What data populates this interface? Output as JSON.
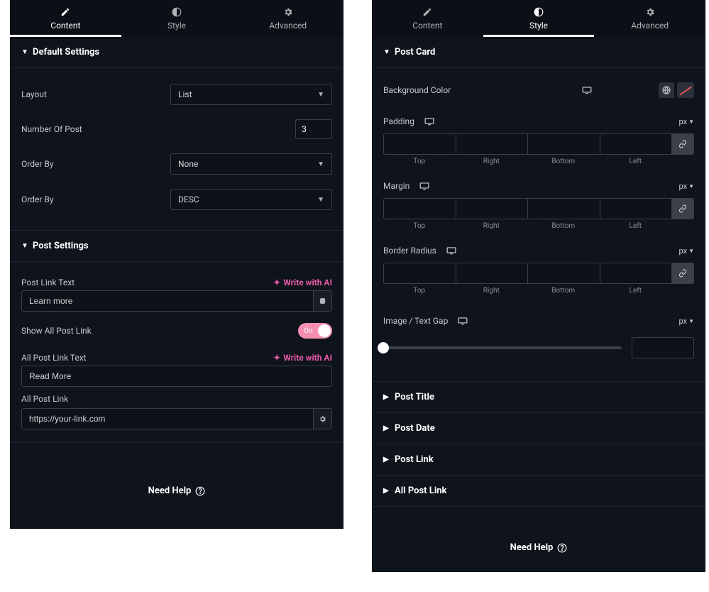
{
  "tabs": {
    "content": "Content",
    "style": "Style",
    "advanced": "Advanced"
  },
  "leftPanel": {
    "defaultSettings": {
      "title": "Default Settings",
      "layout": {
        "label": "Layout",
        "value": "List"
      },
      "numberOfPost": {
        "label": "Number Of Post",
        "value": "3"
      },
      "orderBy1": {
        "label": "Order By",
        "value": "None"
      },
      "orderBy2": {
        "label": "Order By",
        "value": "DESC"
      }
    },
    "postSettings": {
      "title": "Post Settings",
      "postLinkText": {
        "label": "Post Link Text",
        "ai": "Write with AI",
        "value": "Learn more"
      },
      "showAllPostLink": {
        "label": "Show All Post Link",
        "toggle": "On"
      },
      "allPostLinkText": {
        "label": "All Post Link Text",
        "ai": "Write with AI",
        "value": "Read More"
      },
      "allPostLink": {
        "label": "All Post Link",
        "value": "https://your-link.com"
      }
    },
    "help": "Need Help"
  },
  "rightPanel": {
    "postCard": {
      "title": "Post Card",
      "bgColor": {
        "label": "Background Color"
      },
      "padding": {
        "label": "Padding",
        "unit": "px",
        "sides": [
          "Top",
          "Right",
          "Bottom",
          "Left"
        ]
      },
      "margin": {
        "label": "Margin",
        "unit": "px",
        "sides": [
          "Top",
          "Right",
          "Bottom",
          "Left"
        ]
      },
      "borderRadius": {
        "label": "Border Radius",
        "unit": "px",
        "sides": [
          "Top",
          "Right",
          "Bottom",
          "Left"
        ]
      },
      "imageTextGap": {
        "label": "Image / Text Gap",
        "unit": "px"
      }
    },
    "collapsed": {
      "postTitle": "Post Title",
      "postDate": "Post Date",
      "postLink": "Post Link",
      "allPostLink": "All Post Link"
    },
    "help": "Need Help"
  }
}
